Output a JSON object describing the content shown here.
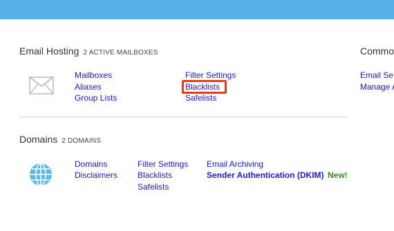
{
  "email_hosting": {
    "title": "Email Hosting",
    "subtitle": "2 ACTIVE MAILBOXES",
    "links_col1": [
      "Mailboxes",
      "Aliases",
      "Group Lists"
    ],
    "links_col2": [
      "Filter Settings",
      "Blacklists",
      "Safelists"
    ]
  },
  "common": {
    "title": "Commo",
    "links": [
      "Email Se",
      "Manage A"
    ]
  },
  "domains": {
    "title": "Domains",
    "subtitle": "2 DOMAINS",
    "links_col1": [
      "Domains",
      "Disclaimers"
    ],
    "links_col2": [
      "Filter Settings",
      "Blacklists",
      "Safelists"
    ],
    "links_col3": [
      "Email Archiving",
      "Sender Authentication (DKIM)"
    ],
    "new_badge": "New!"
  },
  "colors": {
    "topbar": "#56b2e6",
    "link": "#1a1ac0",
    "highlight": "#e53a1e",
    "new_badge": "#3a8a1e"
  },
  "icons": {
    "email_hosting": "envelope-icon",
    "domains": "globe-icon"
  }
}
